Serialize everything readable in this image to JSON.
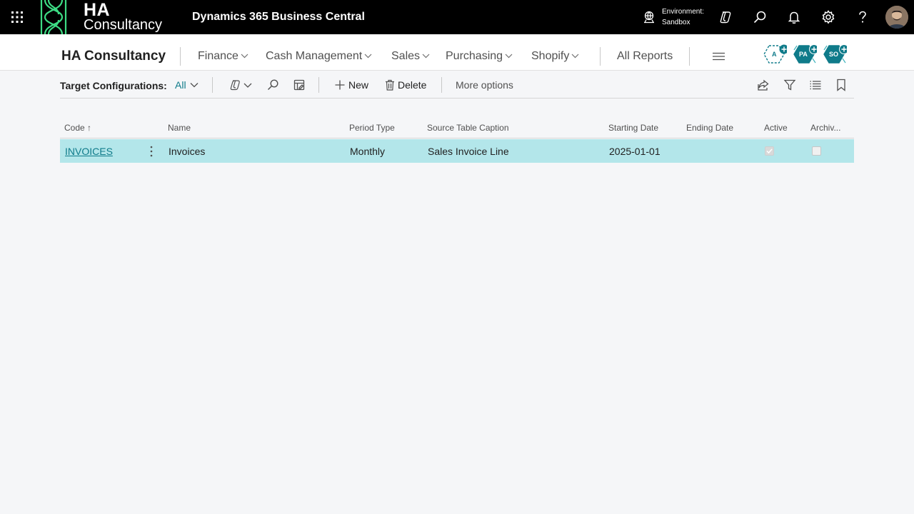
{
  "topbar": {
    "logo_main": "HA",
    "logo_sub": "Consultancy",
    "app_title": "Dynamics 365 Business Central",
    "environment_label": "Environment:",
    "environment_value": "Sandbox"
  },
  "nav": {
    "company": "HA Consultancy",
    "items": [
      {
        "label": "Finance"
      },
      {
        "label": "Cash Management"
      },
      {
        "label": "Sales"
      },
      {
        "label": "Purchasing"
      },
      {
        "label": "Shopify"
      }
    ],
    "all_reports": "All Reports",
    "agents": [
      {
        "label": "A"
      },
      {
        "label": "PA"
      },
      {
        "label": "SO"
      }
    ]
  },
  "actionbar": {
    "page_label": "Target Configurations:",
    "filter_value": "All",
    "new_label": "New",
    "delete_label": "Delete",
    "more_label": "More options"
  },
  "table": {
    "columns": [
      "Code ↑",
      "Name",
      "Period Type",
      "Source Table Caption",
      "Starting Date",
      "Ending Date",
      "Active",
      "Archiv..."
    ],
    "rows": [
      {
        "code": "INVOICES",
        "name": "Invoices",
        "period_type": "Monthly",
        "source_table_caption": "Sales Invoice Line",
        "starting_date": "2025-01-01",
        "ending_date": "",
        "active": true,
        "archived": false
      }
    ]
  },
  "colors": {
    "accent": "#0f7b8a",
    "selected_row": "#b3e6ea",
    "logo_green": "#3ddc84"
  }
}
